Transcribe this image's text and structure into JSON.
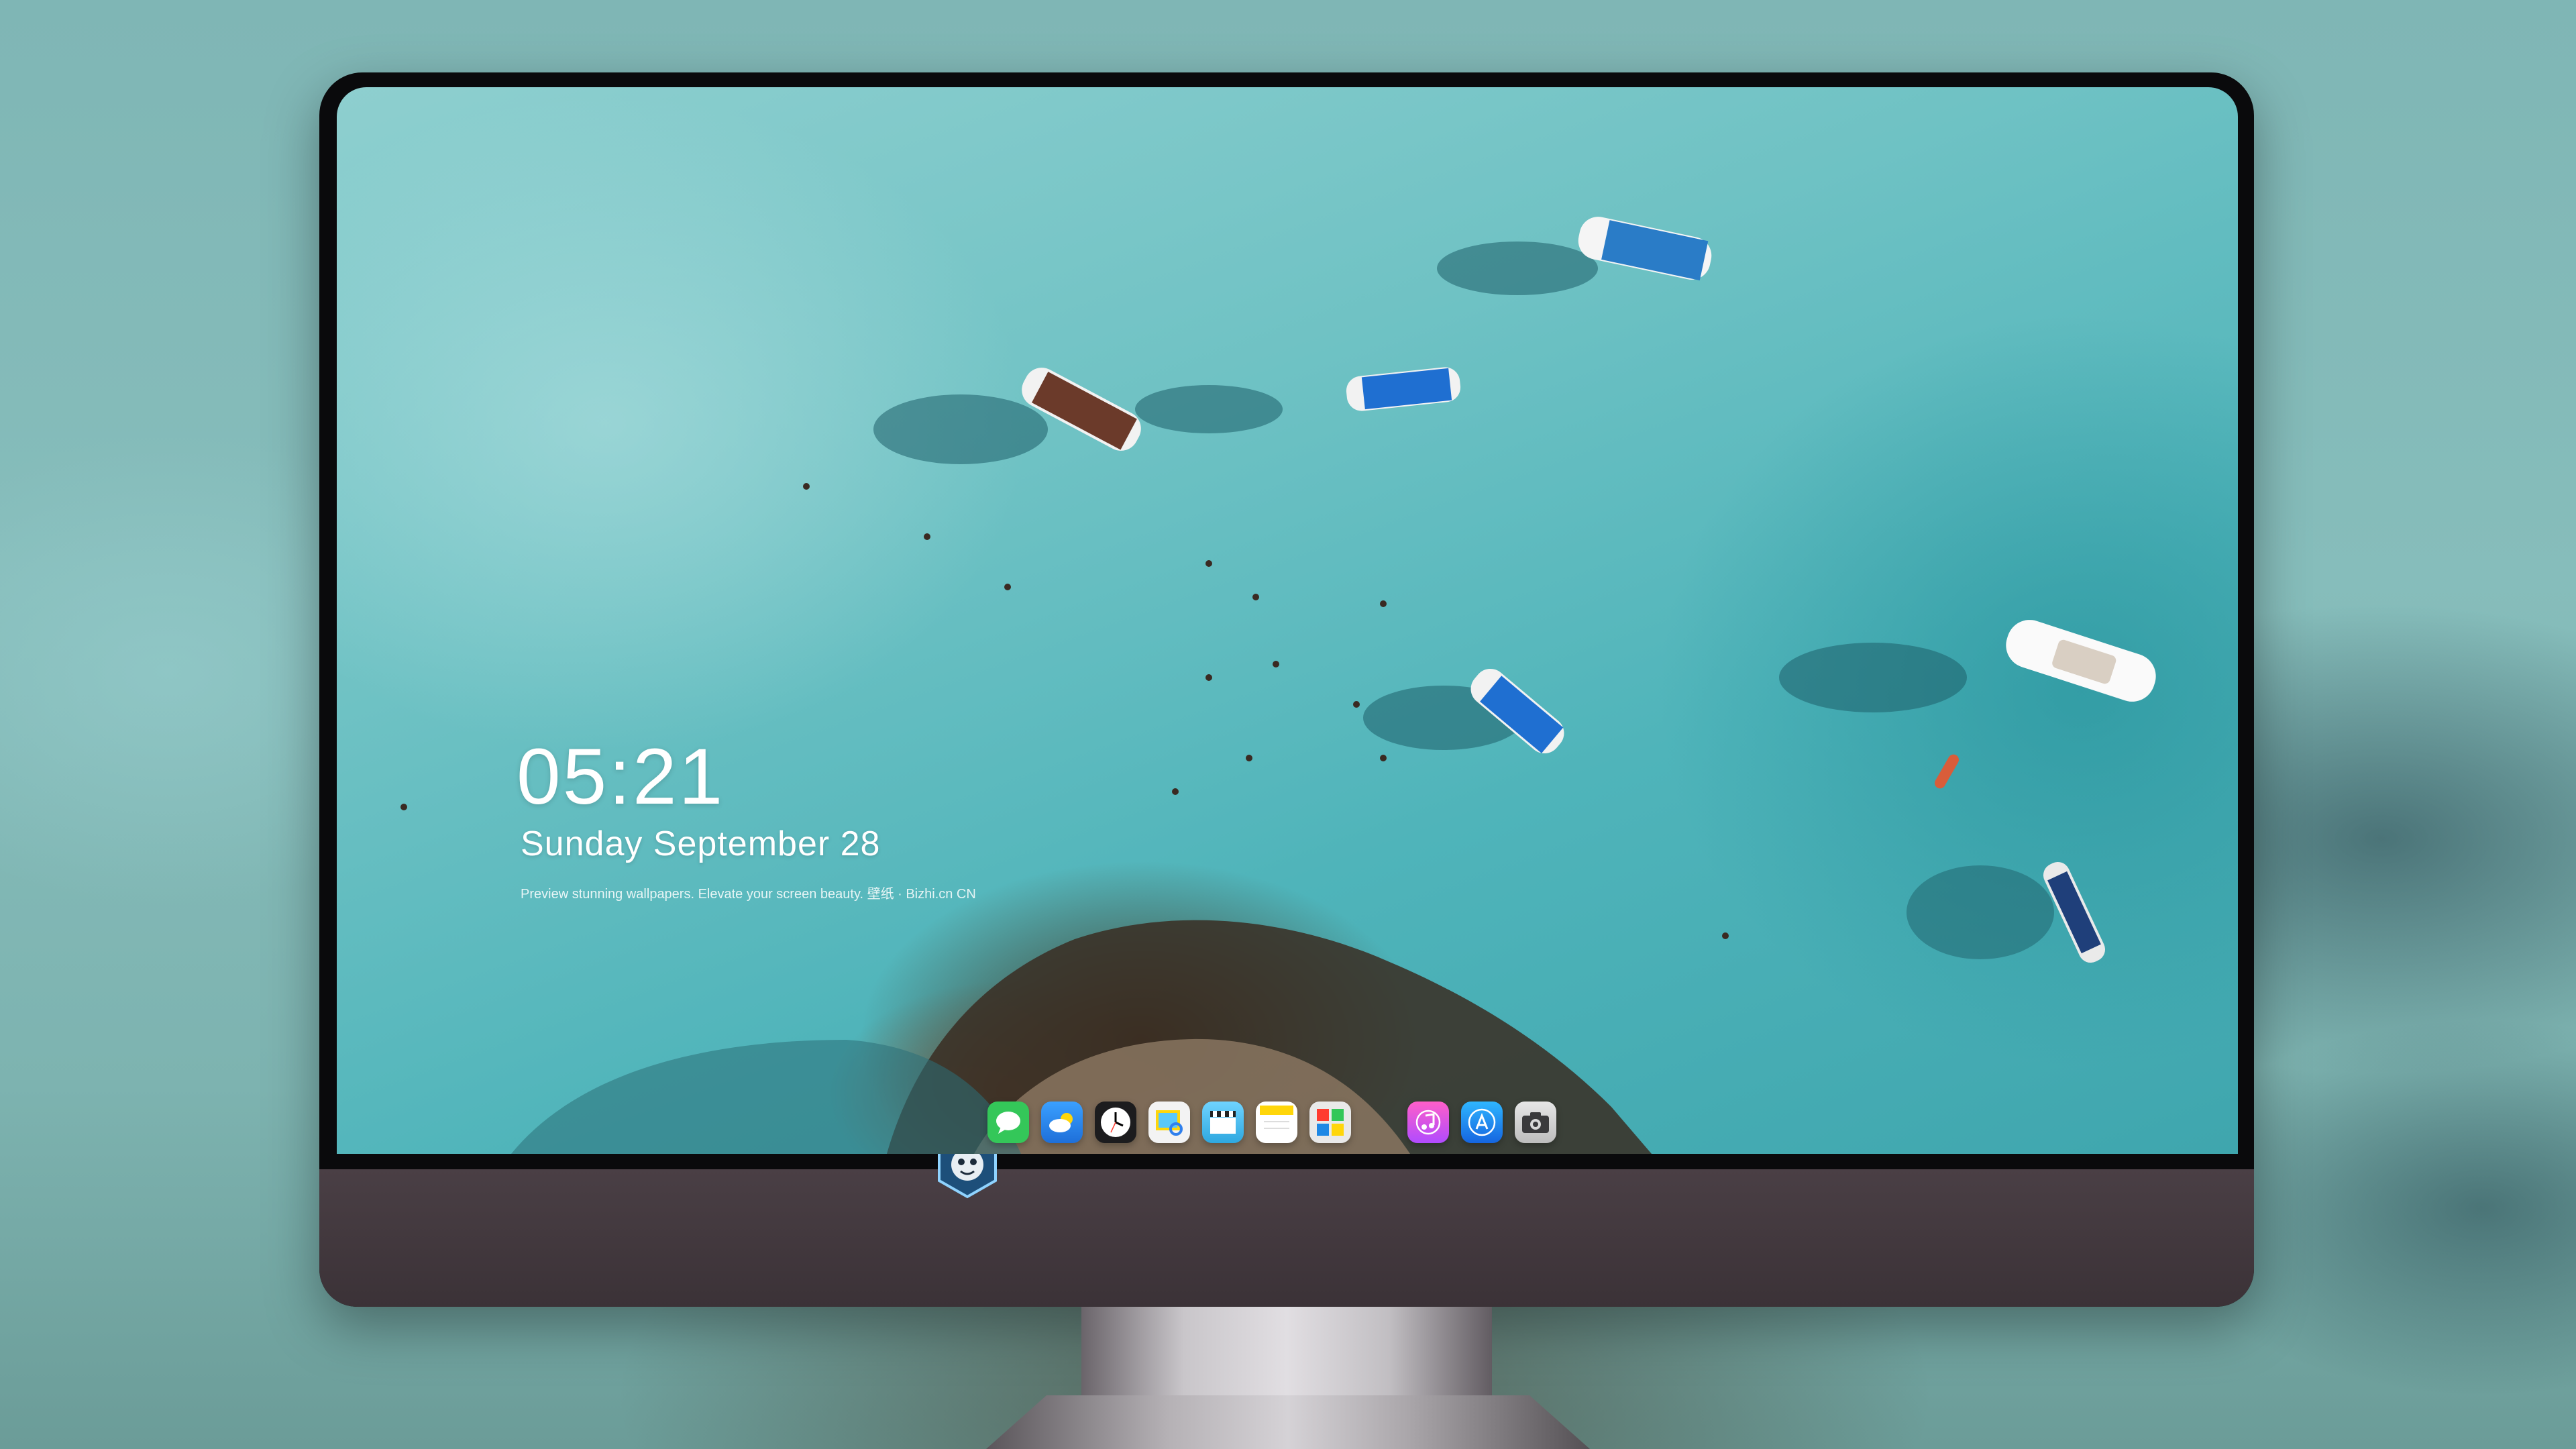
{
  "lockscreen": {
    "time": "05:21",
    "date": "Sunday September  28",
    "tagline": "Preview stunning wallpapers. Elevate your screen beauty. 壁纸 · Bizhi.cn CN"
  },
  "dock": {
    "apps": [
      {
        "name": "messages-icon",
        "color": "#34c759"
      },
      {
        "name": "weather-icon",
        "color": "#1e88e5"
      },
      {
        "name": "clock-icon",
        "color": "#f2f2f2"
      },
      {
        "name": "preview-icon",
        "color": "#f3f3f3"
      },
      {
        "name": "claquette-icon",
        "color": "#5ac8fa"
      },
      {
        "name": "notes-icon",
        "color": "#ffd60a"
      },
      {
        "name": "photo-booth-icon",
        "color": "#e9e9e9"
      },
      {
        "name": "music-icon",
        "color": "#ff2d92"
      },
      {
        "name": "app-store-icon",
        "color": "#1a8cff"
      },
      {
        "name": "camera-icon",
        "color": "#d9d9d9"
      }
    ]
  },
  "colors": {
    "accent": "#4fb4ba",
    "chin": "#3b3237"
  }
}
